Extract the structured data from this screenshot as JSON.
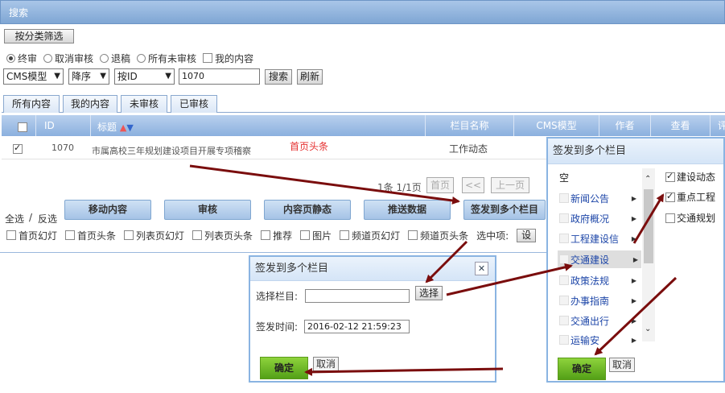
{
  "search_panel": {
    "title": "搜索",
    "filter_button": "按分类筛选"
  },
  "status_filters": [
    {
      "label": "终审",
      "checked": true
    },
    {
      "label": "取消审核",
      "checked": false
    },
    {
      "label": "退稿",
      "checked": false
    },
    {
      "label": "所有未审核",
      "checked": false
    }
  ],
  "my_content": "我的内容",
  "toolbar": {
    "model": "CMS模型",
    "order": "降序",
    "field": "按ID",
    "query": "1070",
    "search": "搜索",
    "refresh": "刷新"
  },
  "tabs": [
    "所有内容",
    "我的内容",
    "未审核",
    "已审核"
  ],
  "table": {
    "headers": {
      "id": "ID",
      "title": "标题",
      "column": "栏目名称",
      "model": "CMS模型",
      "author": "作者",
      "view": "查看",
      "comment": "评"
    },
    "row": {
      "id": "1070",
      "title": "市属高校三年规划建设项目开展专项稽察",
      "column": "工作动态",
      "tag": "首页头条"
    }
  },
  "pager": {
    "info": "1条 1/1页",
    "first": "首页",
    "prev2": "<<",
    "prev": "上一页"
  },
  "select_all": "全选",
  "invert": "反选",
  "actions": [
    "移动内容",
    "审核",
    "内容页静态",
    "推送数据",
    "签发到多个栏目"
  ],
  "flags": [
    "首页幻灯",
    "首页头条",
    "列表页幻灯",
    "列表页头条",
    "推荐",
    "图片",
    "频道页幻灯",
    "频道页头条"
  ],
  "selected_label": "选中项:",
  "selected_btn": "设",
  "dialog_small": {
    "title": "签发到多个栏目",
    "close": "✕",
    "column_label": "选择栏目:",
    "choose": "选择",
    "time_label": "签发时间:",
    "time_value": "2016-02-12 21:59:23",
    "ok": "确定",
    "cancel": "取消"
  },
  "dialog_large": {
    "title": "签发到多个栏目",
    "empty": "空",
    "left_items": [
      "新闻公告",
      "政府概况",
      "工程建设信",
      "交通建设",
      "政策法规",
      "办事指南",
      "交通出行",
      "运输安"
    ],
    "right_items": [
      {
        "label": "建设动态",
        "checked": true
      },
      {
        "label": "重点工程",
        "checked": true
      },
      {
        "label": "交通规划",
        "checked": false
      }
    ],
    "ok": "确定",
    "cancel": "取消"
  }
}
